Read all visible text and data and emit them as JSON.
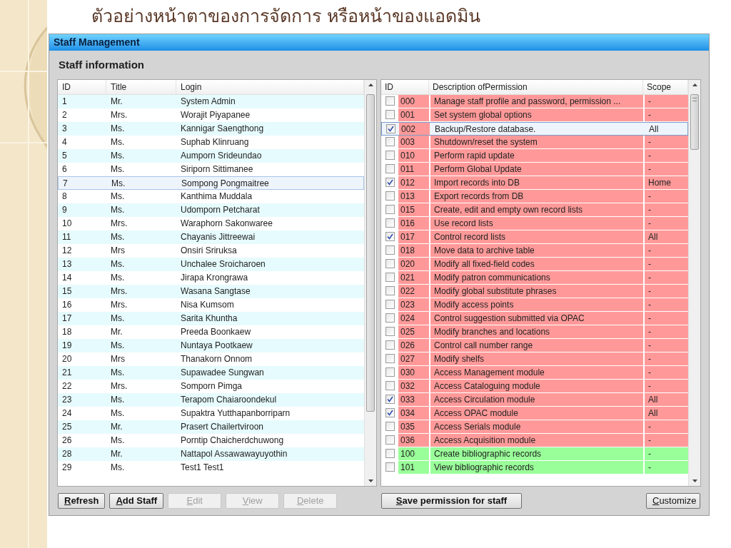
{
  "slide_title": "ตัวอย่างหน้าตาของการจัดการ หรือหน้าของแอดมิน",
  "window": {
    "title": "Staff Management"
  },
  "section_title": "Staff information",
  "staff_table": {
    "columns": [
      "ID",
      "Title",
      "Login"
    ],
    "rows": [
      {
        "id": "1",
        "title": "Mr.",
        "login": "System Admin",
        "selected": false
      },
      {
        "id": "2",
        "title": "Mrs.",
        "login": "Worajit Piyapanee",
        "selected": false
      },
      {
        "id": "3",
        "title": "Ms.",
        "login": "Kannigar Saengthong",
        "selected": false
      },
      {
        "id": "4",
        "title": "Ms.",
        "login": "Suphab Klinruang",
        "selected": false
      },
      {
        "id": "5",
        "title": "Ms.",
        "login": "Aumporn Srideundao",
        "selected": false
      },
      {
        "id": "6",
        "title": "Ms.",
        "login": "Siriporn Sittimanee",
        "selected": false
      },
      {
        "id": "7",
        "title": "Ms.",
        "login": "Sompong Pongmaitree",
        "selected": true
      },
      {
        "id": "8",
        "title": "Ms.",
        "login": "Kanthima  Muddala",
        "selected": false
      },
      {
        "id": "9",
        "title": "Ms.",
        "login": "Udomporn Petcharat",
        "selected": false
      },
      {
        "id": "10",
        "title": "Mrs.",
        "login": "Waraphorn Sakonwaree",
        "selected": false
      },
      {
        "id": "11",
        "title": "Ms.",
        "login": "Chayanis Jittreewai",
        "selected": false
      },
      {
        "id": "12",
        "title": "Mrs",
        "login": "Onsiri Sriruksa",
        "selected": false
      },
      {
        "id": "13",
        "title": "Ms.",
        "login": "Unchalee Sroicharoen",
        "selected": false
      },
      {
        "id": "14",
        "title": "Ms.",
        "login": "Jirapa Krongrawa",
        "selected": false
      },
      {
        "id": "15",
        "title": "Mrs.",
        "login": "Wasana Sangtase",
        "selected": false
      },
      {
        "id": "16",
        "title": "Mrs.",
        "login": "Nisa  Kumsom",
        "selected": false
      },
      {
        "id": "17",
        "title": "Ms.",
        "login": "Sarita Khuntha",
        "selected": false
      },
      {
        "id": "18",
        "title": "Mr.",
        "login": "Preeda Boonkaew",
        "selected": false
      },
      {
        "id": "19",
        "title": "Ms.",
        "login": "Nuntaya Pootkaew",
        "selected": false
      },
      {
        "id": "20",
        "title": "Mrs",
        "login": "Thanakorn  Onnom",
        "selected": false
      },
      {
        "id": "21",
        "title": "Ms.",
        "login": "Supawadee Sungwan",
        "selected": false
      },
      {
        "id": "22",
        "title": "Mrs.",
        "login": "Somporn Pimga",
        "selected": false
      },
      {
        "id": "23",
        "title": "Ms.",
        "login": "Terapom Chaiaroondekul",
        "selected": false
      },
      {
        "id": "24",
        "title": "Ms.",
        "login": "Supaktra Yutthapanborriparn",
        "selected": false
      },
      {
        "id": "25",
        "title": "Mr.",
        "login": "Prasert Chailertviroon",
        "selected": false
      },
      {
        "id": "26",
        "title": "Ms.",
        "login": "Porntip Chaicherdchuwong",
        "selected": false
      },
      {
        "id": "28",
        "title": "Mr.",
        "login": "Nattapol Assawawayuyothin",
        "selected": false
      },
      {
        "id": "29",
        "title": "Ms.",
        "login": "Test1 Test1",
        "selected": false
      }
    ]
  },
  "permission_table": {
    "columns": [
      "ID",
      "Description ofPermission",
      "Scope"
    ],
    "rows": [
      {
        "checked": false,
        "id": "000",
        "description": "Manage staff profile and password, permission ...",
        "scope": "-",
        "color": "#ff9999",
        "selected": false
      },
      {
        "checked": false,
        "id": "001",
        "description": "Set system global options",
        "scope": "-",
        "color": "#ff9999",
        "selected": false
      },
      {
        "checked": true,
        "id": "002",
        "description": "Backup/Restore database.",
        "scope": "All",
        "color": "#ff9999",
        "selected": true
      },
      {
        "checked": false,
        "id": "003",
        "description": "Shutdown/reset the system",
        "scope": "-",
        "color": "#ff9999",
        "selected": false
      },
      {
        "checked": false,
        "id": "010",
        "description": "Perform rapid update",
        "scope": "-",
        "color": "#ff9999",
        "selected": false
      },
      {
        "checked": false,
        "id": "011",
        "description": "Perform Global Update",
        "scope": "-",
        "color": "#ff9999",
        "selected": false
      },
      {
        "checked": true,
        "id": "012",
        "description": "Import records into DB",
        "scope": "Home",
        "color": "#ff9999",
        "selected": false
      },
      {
        "checked": false,
        "id": "013",
        "description": "Export records from DB",
        "scope": "-",
        "color": "#ff9999",
        "selected": false
      },
      {
        "checked": false,
        "id": "015",
        "description": "Create, edit and empty own record lists",
        "scope": "-",
        "color": "#ff9999",
        "selected": false
      },
      {
        "checked": false,
        "id": "016",
        "description": "Use record lists",
        "scope": "-",
        "color": "#ff9999",
        "selected": false
      },
      {
        "checked": true,
        "id": "017",
        "description": "Control record lists",
        "scope": "All",
        "color": "#ff9999",
        "selected": false
      },
      {
        "checked": false,
        "id": "018",
        "description": "Move data to archive table",
        "scope": "-",
        "color": "#ff9999",
        "selected": false
      },
      {
        "checked": false,
        "id": "020",
        "description": "Modify all fixed-field codes",
        "scope": "-",
        "color": "#ff9999",
        "selected": false
      },
      {
        "checked": false,
        "id": "021",
        "description": "Modify patron communications",
        "scope": "-",
        "color": "#ff9999",
        "selected": false
      },
      {
        "checked": false,
        "id": "022",
        "description": "Modify global substitute phrases",
        "scope": "-",
        "color": "#ff9999",
        "selected": false
      },
      {
        "checked": false,
        "id": "023",
        "description": "Modify access points",
        "scope": "-",
        "color": "#ff9999",
        "selected": false
      },
      {
        "checked": false,
        "id": "024",
        "description": "Control suggestion submitted via OPAC",
        "scope": "-",
        "color": "#ff9999",
        "selected": false
      },
      {
        "checked": false,
        "id": "025",
        "description": "Modify branches and locations",
        "scope": "-",
        "color": "#ff9999",
        "selected": false
      },
      {
        "checked": false,
        "id": "026",
        "description": "Control call number range",
        "scope": "-",
        "color": "#ff9999",
        "selected": false
      },
      {
        "checked": false,
        "id": "027",
        "description": "Modify shelfs",
        "scope": "-",
        "color": "#ff9999",
        "selected": false
      },
      {
        "checked": false,
        "id": "030",
        "description": "Access Management module",
        "scope": "-",
        "color": "#ff9999",
        "selected": false
      },
      {
        "checked": false,
        "id": "032",
        "description": "Access Cataloguing module",
        "scope": "-",
        "color": "#ff9999",
        "selected": false
      },
      {
        "checked": true,
        "id": "033",
        "description": "Access Circulation module",
        "scope": "All",
        "color": "#ff9999",
        "selected": false
      },
      {
        "checked": true,
        "id": "034",
        "description": "Access OPAC module",
        "scope": "All",
        "color": "#ff9999",
        "selected": false
      },
      {
        "checked": false,
        "id": "035",
        "description": "Access Serials module",
        "scope": "-",
        "color": "#ff9999",
        "selected": false
      },
      {
        "checked": false,
        "id": "036",
        "description": "Access Acquisition module",
        "scope": "-",
        "color": "#ff9999",
        "selected": false
      },
      {
        "checked": false,
        "id": "100",
        "description": "Create bibliographic records",
        "scope": "-",
        "color": "#99ff99",
        "selected": false
      },
      {
        "checked": false,
        "id": "101",
        "description": "View bibliographic records",
        "scope": "-",
        "color": "#99ff99",
        "selected": false
      }
    ]
  },
  "staff_buttons": [
    {
      "label": "Refresh",
      "disabled": false
    },
    {
      "label": "Add Staff",
      "disabled": false
    },
    {
      "label": "Edit",
      "disabled": true
    },
    {
      "label": "View",
      "disabled": true
    },
    {
      "label": "Delete",
      "disabled": true
    }
  ],
  "permission_buttons": [
    {
      "label": "Save permission for staff",
      "disabled": false
    },
    {
      "label": "Customize",
      "disabled": false
    }
  ]
}
